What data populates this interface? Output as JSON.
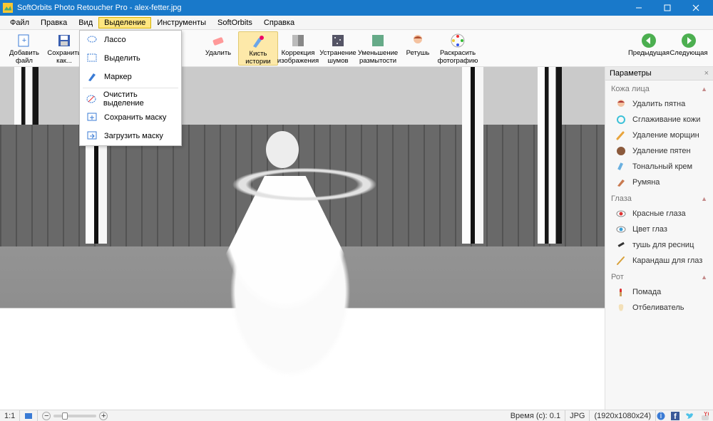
{
  "window": {
    "title": "SoftOrbits Photo Retoucher Pro - alex-fetter.jpg"
  },
  "menubar": {
    "file": "Файл",
    "edit": "Правка",
    "view": "Вид",
    "selection": "Выделение",
    "tools": "Инструменты",
    "softorbits": "SoftOrbits",
    "help": "Справка"
  },
  "dropdown": {
    "lasso": "Лассо",
    "select": "Выделить",
    "marker": "Маркер",
    "clear_selection": "Очистить выделение",
    "save_mask": "Сохранить маску",
    "load_mask": "Загрузить маску"
  },
  "toolbar": {
    "add_file": "Добавить файл",
    "save_as": "Сохранить как...",
    "delete": "Удалить",
    "history_brush": "Кисть истории",
    "image_correction": "Коррекция изображения",
    "noise_removal": "Устранение шумов",
    "deblur": "Уменьшение размытости",
    "retouch": "Ретушь",
    "colorize": "Раскрасить фотографию",
    "prev": "Предыдущая",
    "next": "Следующая"
  },
  "side": {
    "header": "Параметры",
    "skin_section": "Кожа лица",
    "skin": {
      "remove_spots": "Удалить пятна",
      "skin_smoothing": "Сглаживание кожи",
      "wrinkle_removal": "Удаление морщин",
      "stain_removal": "Удаление пятен",
      "foundation": "Тональный крем",
      "blush": "Румяна"
    },
    "eyes_section": "Глаза",
    "eyes": {
      "red_eyes": "Красные глаза",
      "eye_color": "Цвет глаз",
      "mascara": "тушь для ресниц",
      "eyeliner": "Карандаш для глаз"
    },
    "mouth_section": "Рот",
    "mouth": {
      "lipstick": "Помада",
      "whitener": "Отбеливатель"
    }
  },
  "status": {
    "zoom_label": "1:1",
    "time_label": "Время (с): 0.1",
    "format": "JPG",
    "dimensions": "(1920x1080x24)"
  }
}
